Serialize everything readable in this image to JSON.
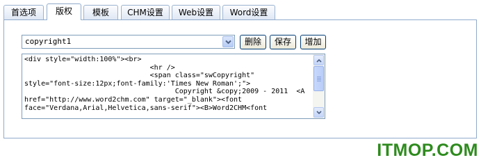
{
  "tabs": [
    {
      "label": "首选项",
      "active": false
    },
    {
      "label": "版权",
      "active": true
    },
    {
      "label": "模板",
      "active": false
    },
    {
      "label": "CHM设置",
      "active": false
    },
    {
      "label": "Web设置",
      "active": false
    },
    {
      "label": "Word设置",
      "active": false
    }
  ],
  "select": {
    "value": "copyright1"
  },
  "buttons": {
    "delete": "删除",
    "save": "保存",
    "add": "增加"
  },
  "editor": {
    "lines": [
      "<div style=\"width:100%\"><br>",
      "                              <hr />",
      "                              <span class=\"swCopyright\"",
      "style=\"font-size:12px;font-family:'Times New Roman';\">",
      "                                    Copyright &copy;2009 - 2011  <A",
      "href=\"http://www.word2chm.com\" target=\"_blank\"><font",
      "face=\"Verdana,Arial,Helvetica,sans-serif\"><B>Word2CHM<font"
    ]
  },
  "watermark": "ITMOP.COM"
}
